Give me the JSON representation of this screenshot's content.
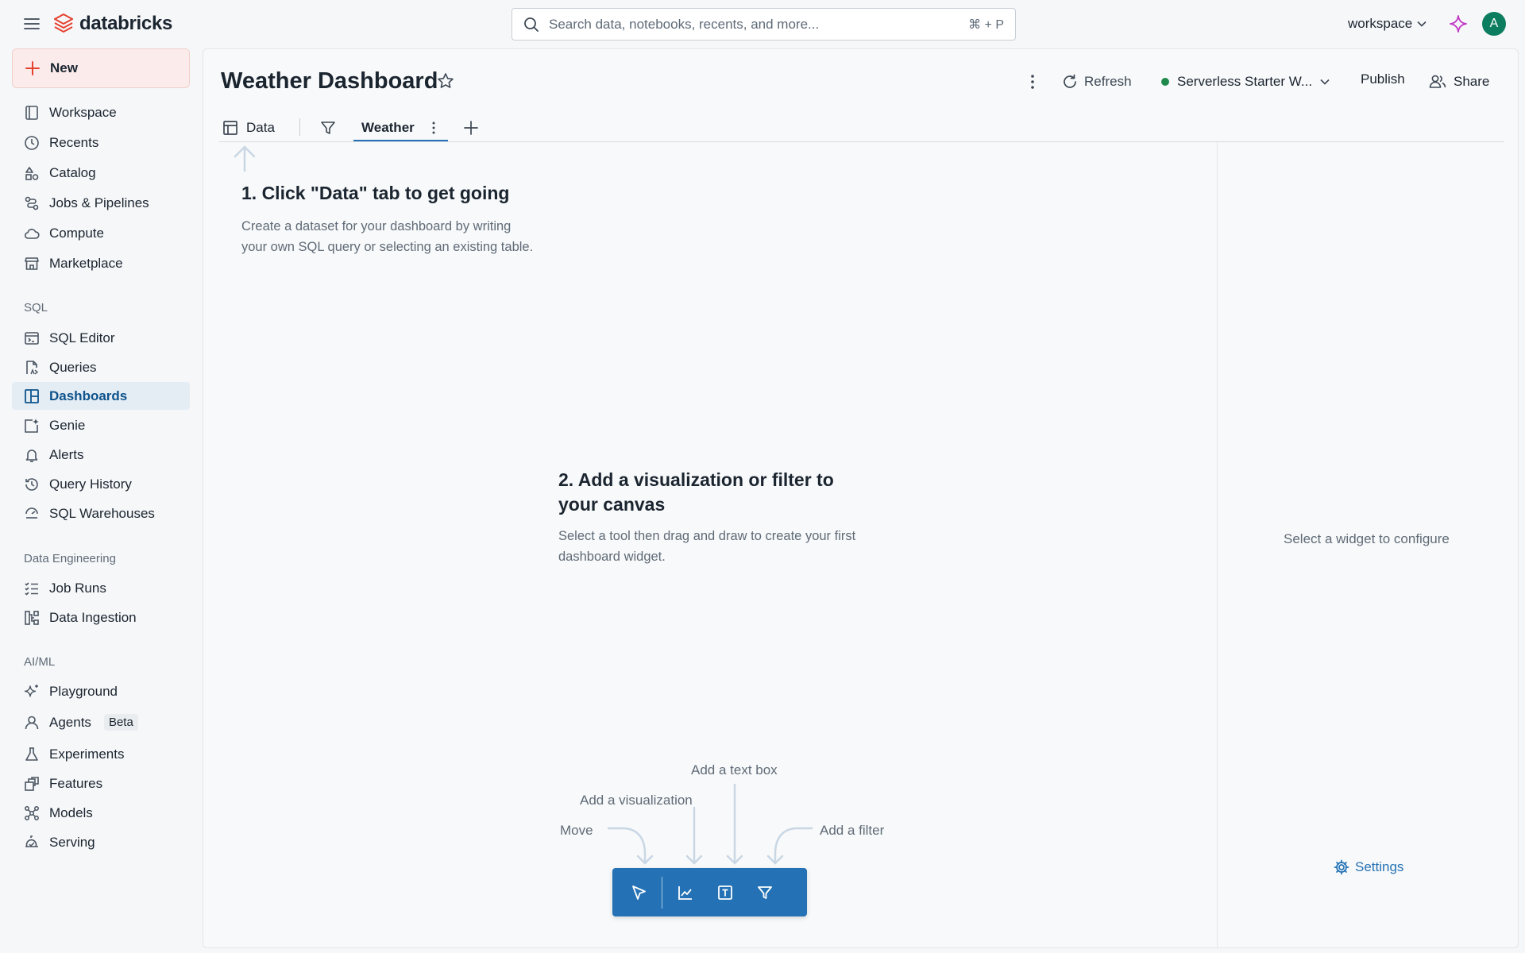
{
  "topbar": {
    "brand": "databricks",
    "search_placeholder": "Search data, notebooks, recents, and more...",
    "search_shortcut": "⌘ + P",
    "workspace_label": "workspace",
    "avatar_initial": "A"
  },
  "sidebar": {
    "new_label": "New",
    "primary": [
      {
        "label": "Workspace",
        "icon": "workspace-icon"
      },
      {
        "label": "Recents",
        "icon": "clock-icon"
      },
      {
        "label": "Catalog",
        "icon": "catalog-icon"
      },
      {
        "label": "Jobs & Pipelines",
        "icon": "jobs-icon"
      },
      {
        "label": "Compute",
        "icon": "cloud-icon"
      },
      {
        "label": "Marketplace",
        "icon": "store-icon"
      }
    ],
    "sql_section": "SQL",
    "sql": [
      {
        "label": "SQL Editor",
        "icon": "sql-editor-icon"
      },
      {
        "label": "Queries",
        "icon": "queries-icon"
      },
      {
        "label": "Dashboards",
        "icon": "dashboard-icon",
        "active": true
      },
      {
        "label": "Genie",
        "icon": "genie-icon"
      },
      {
        "label": "Alerts",
        "icon": "bell-icon"
      },
      {
        "label": "Query History",
        "icon": "history-icon"
      },
      {
        "label": "SQL Warehouses",
        "icon": "warehouse-icon"
      }
    ],
    "de_section": "Data Engineering",
    "data_engineering": [
      {
        "label": "Job Runs",
        "icon": "job-runs-icon"
      },
      {
        "label": "Data Ingestion",
        "icon": "ingestion-icon"
      }
    ],
    "ml_section": "AI/ML",
    "ml": [
      {
        "label": "Playground",
        "icon": "sparkle-icon"
      },
      {
        "label": "Agents",
        "icon": "agent-icon",
        "badge": "Beta"
      },
      {
        "label": "Experiments",
        "icon": "flask-icon"
      },
      {
        "label": "Features",
        "icon": "features-icon"
      },
      {
        "label": "Models",
        "icon": "models-icon"
      },
      {
        "label": "Serving",
        "icon": "serving-icon"
      }
    ]
  },
  "dashboard": {
    "title": "Weather Dashboard",
    "refresh_label": "Refresh",
    "warehouse_label": "Serverless Starter W...",
    "warehouse_status_color": "#1f8a4c",
    "publish_label": "Publish",
    "share_label": "Share",
    "tabs": [
      {
        "label": "Data"
      },
      {
        "label": "Weather",
        "active": true
      }
    ]
  },
  "canvas": {
    "step1_title": "1. Click \"Data\" tab to get going",
    "step1_body": "Create a dataset for your dashboard by writing your own SQL query or selecting an existing table.",
    "step2_title": "2. Add a visualization or filter to your canvas",
    "step2_body": "Select a tool then drag and draw to create your first dashboard widget.",
    "hint_move": "Move",
    "hint_visualization": "Add a visualization",
    "hint_textbox": "Add a text box",
    "hint_filter": "Add a filter"
  },
  "right_panel": {
    "empty_message": "Select a widget to configure",
    "settings_label": "Settings"
  },
  "colors": {
    "accent": "#2472b5",
    "new_button_bg": "#fbeceb",
    "active_nav_bg": "#e4ecf4",
    "brand_red": "#e5412f"
  }
}
